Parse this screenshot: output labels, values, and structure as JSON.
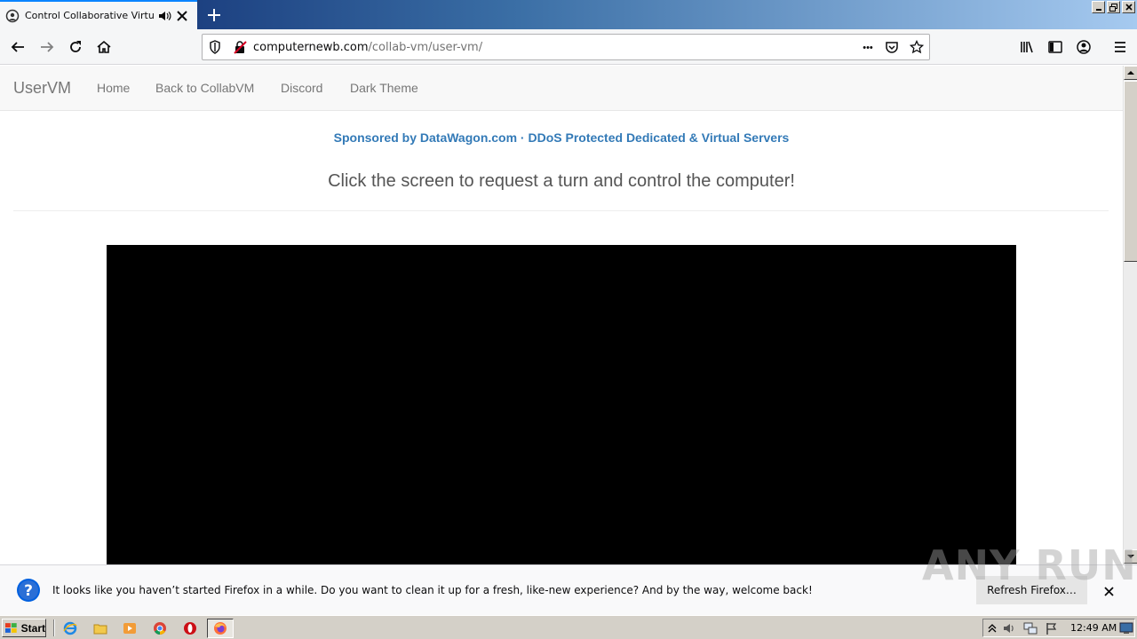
{
  "browser": {
    "tab_title": "Control Collaborative Virtual M",
    "url_host": "computernewb.com",
    "url_path": "/collab-vm/user-vm/",
    "page_actions": "•••"
  },
  "site": {
    "brand": "UserVM",
    "nav": [
      {
        "label": "Home"
      },
      {
        "label": "Back to CollabVM"
      },
      {
        "label": "Discord"
      },
      {
        "label": "Dark Theme"
      }
    ],
    "sponsor": "Sponsored by DataWagon.com · DDoS Protected Dedicated & Virtual Servers",
    "headline": "Click the screen to request a turn and control the computer!"
  },
  "notification": {
    "message": "It looks like you haven’t started Firefox in a while. Do you want to clean it up for a fresh, like-new experience? And by the way, welcome back!",
    "button": "Refresh Firefox…"
  },
  "watermark": "ANY RUN",
  "taskbar": {
    "start_label": "Start",
    "clock": "12:49 AM"
  },
  "colors": {
    "link": "#337ab7",
    "navbar_bg": "#f8f8f8",
    "vm_screen": "#000000"
  },
  "icons": [
    "privacy-icon",
    "home-icon",
    "reload-icon",
    "library-icon",
    "sidebar-icon",
    "account-icon",
    "menu-icon",
    "pocket-icon",
    "bookmark-star-icon"
  ]
}
